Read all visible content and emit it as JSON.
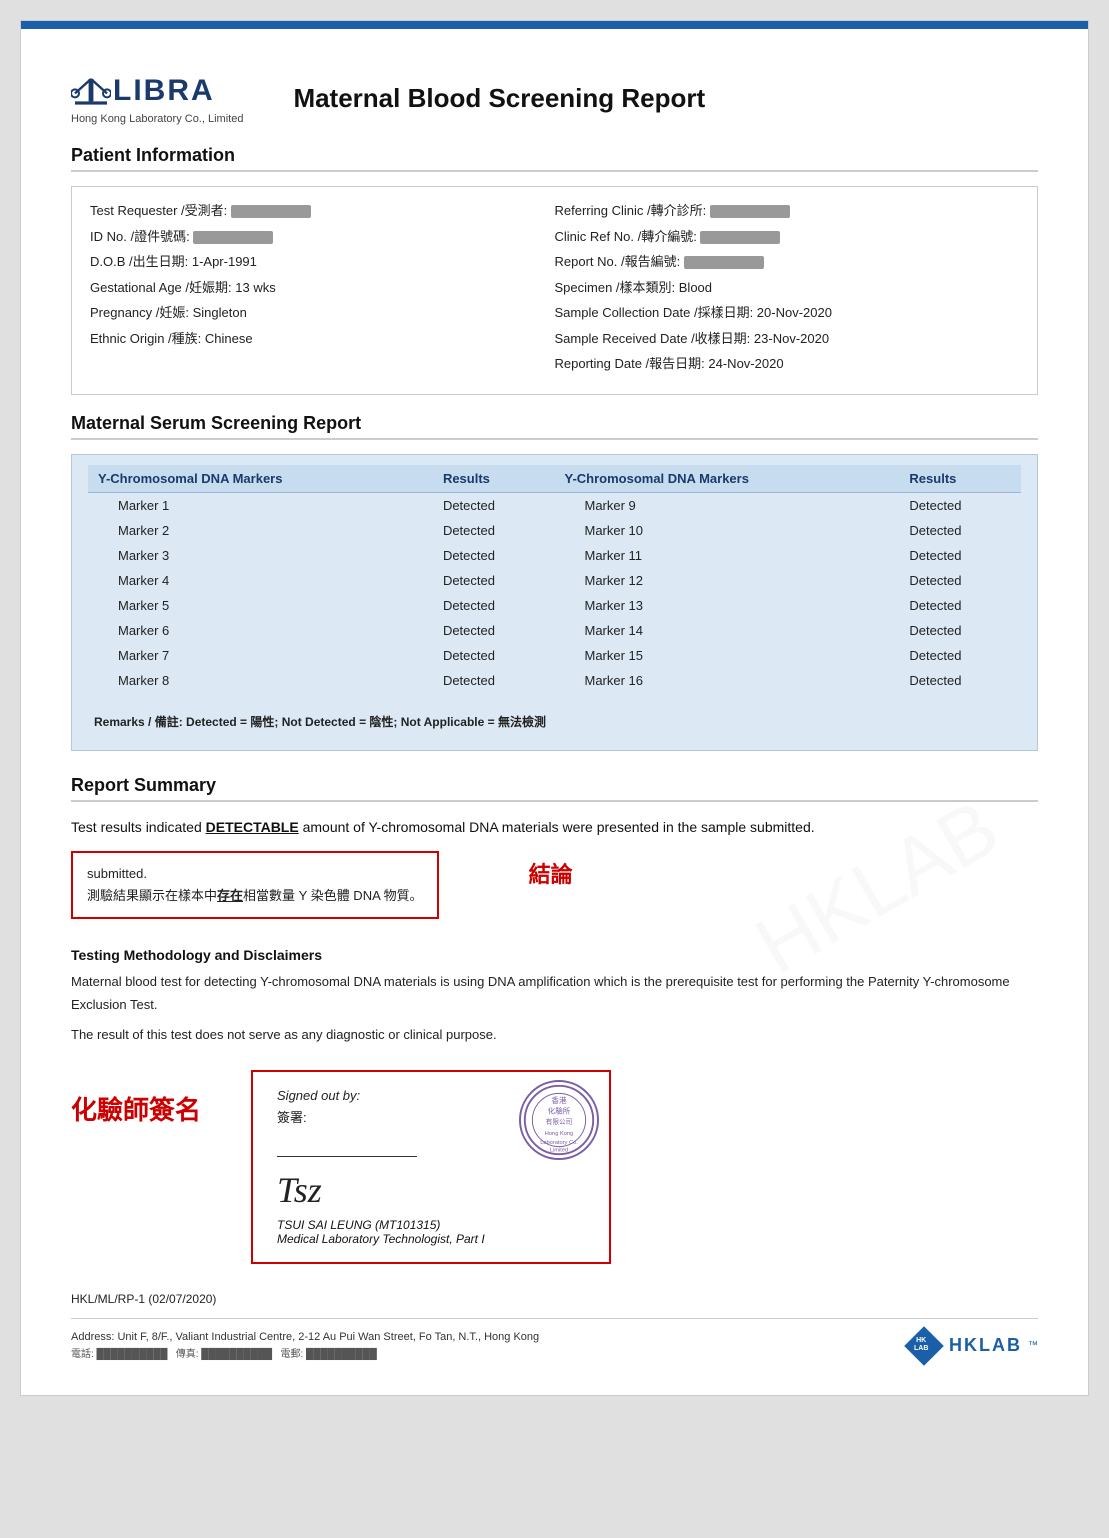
{
  "company": {
    "name": "LIBRA",
    "subtitle": "Hong Kong Laboratory Co., Limited",
    "report_title": "Maternal Blood Screening Report"
  },
  "patient_info": {
    "section_title": "Patient Information",
    "left": [
      {
        "label": "Test Requester /受測者:",
        "value": "REDACTED"
      },
      {
        "label": "ID No. /證件號碼:",
        "value": "REDACTED"
      },
      {
        "label": "D.O.B /出生日期:",
        "value": "1-Apr-1991"
      },
      {
        "label": "Gestational Age /妊娠期:",
        "value": "13 wks"
      },
      {
        "label": "Pregnancy /妊娠:",
        "value": "Singleton"
      },
      {
        "label": "Ethnic Origin /種族:",
        "value": "Chinese"
      }
    ],
    "right": [
      {
        "label": "Referring Clinic /轉介診所:",
        "value": "REDACTED"
      },
      {
        "label": "Clinic Ref No. /轉介編號:",
        "value": "REDACTED"
      },
      {
        "label": "Report No. /報告編號:",
        "value": "REDACTED"
      },
      {
        "label": "Specimen /樣本類別:",
        "value": "Blood"
      },
      {
        "label": "Sample Collection Date /採樣日期:",
        "value": "20-Nov-2020"
      },
      {
        "label": "Sample Received Date /收樣日期:",
        "value": "23-Nov-2020"
      },
      {
        "label": "Reporting Date /報告日期:",
        "value": "24-Nov-2020"
      }
    ]
  },
  "serum_screening": {
    "section_title": "Maternal Serum Screening Report",
    "col1_header": "Y-Chromosomal DNA Markers",
    "col2_header": "Results",
    "col3_header": "Y-Chromosomal DNA Markers",
    "col4_header": "Results",
    "rows": [
      {
        "marker_left": "Marker 1",
        "result_left": "Detected",
        "marker_right": "Marker 9",
        "result_right": "Detected"
      },
      {
        "marker_left": "Marker 2",
        "result_left": "Detected",
        "marker_right": "Marker 10",
        "result_right": "Detected"
      },
      {
        "marker_left": "Marker 3",
        "result_left": "Detected",
        "marker_right": "Marker 11",
        "result_right": "Detected"
      },
      {
        "marker_left": "Marker 4",
        "result_left": "Detected",
        "marker_right": "Marker 12",
        "result_right": "Detected"
      },
      {
        "marker_left": "Marker 5",
        "result_left": "Detected",
        "marker_right": "Marker 13",
        "result_right": "Detected"
      },
      {
        "marker_left": "Marker 6",
        "result_left": "Detected",
        "marker_right": "Marker 14",
        "result_right": "Detected"
      },
      {
        "marker_left": "Marker 7",
        "result_left": "Detected",
        "marker_right": "Marker 15",
        "result_right": "Detected"
      },
      {
        "marker_left": "Marker 8",
        "result_left": "Detected",
        "marker_right": "Marker 16",
        "result_right": "Detected"
      }
    ],
    "remarks": "Remarks / 備註: Detected = 陽性; Not Detected = 陰性; Not Applicable = 無法檢測"
  },
  "report_summary": {
    "section_title": "Report Summary",
    "summary_line1": "Test results indicated ",
    "detectable": "DETECTABLE",
    "summary_line2": " amount of Y-chromosomal DNA materials were presented in the sample",
    "summary_line3": "submitted.",
    "box_en": "submitted.",
    "box_zh": "測驗結果顯示在樣本中",
    "box_zh_bold": "存在",
    "box_zh_end": "相當數量 Y 染色體 DNA 物質。",
    "conclusion_label": "結論"
  },
  "methodology": {
    "title": "Testing Methodology and Disclaimers",
    "para1": "Maternal blood test for detecting Y-chromosomal DNA materials is using DNA amplification which is the prerequisite test for performing the Paternity Y-chromosome Exclusion Test.",
    "para2": "The result of this test does not serve as any diagnostic or clinical purpose."
  },
  "signature": {
    "label_zh": "化驗師簽名",
    "signed_out_by": "Signed out by:",
    "signed_out_zh": "簽署:",
    "stamp_text": "香港\n化驗所\n有限公司\nHong Kong\nLaboratory Co.\nLimited",
    "signer_name": "TSUI SAI LEUNG (MT101315)",
    "signer_title": "Medical Laboratory Technologist, Part I"
  },
  "footer": {
    "ref": "HKL/ML/RP-1 (02/07/2020)",
    "address": "Address: Unit F, 8/F., Valiant Industrial Centre, 2-12 Au Pui Wan Street, Fo Tan, N.T., Hong Kong",
    "contacts": "電話: (redacted)   傳真: (redacted)   電郵: (redacted)",
    "hklab": "HKLAB"
  }
}
